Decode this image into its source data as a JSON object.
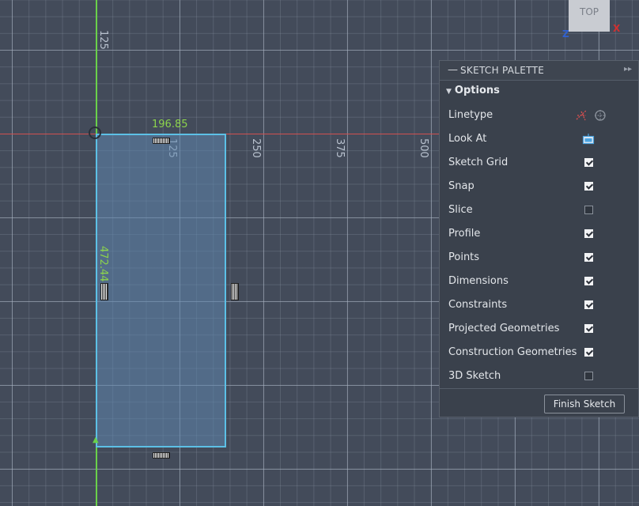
{
  "viewport": {
    "ticks": {
      "t1": "125",
      "t2": "125",
      "t3": "250",
      "t4": "375",
      "t5": "500"
    },
    "dimensions": {
      "width": "196.85",
      "height": "472.44"
    },
    "viewcube": {
      "face": "TOP",
      "axis_z": "Z",
      "axis_x": "X"
    },
    "colors": {
      "x_axis": "#d05050",
      "y_axis": "#6ad14a",
      "profile": "#5cc0e6",
      "dimension": "#8cd44c"
    }
  },
  "palette": {
    "title": "SKETCH PALETTE",
    "section": "Options",
    "rows": [
      {
        "label": "Linetype",
        "type": "icons"
      },
      {
        "label": "Look At",
        "type": "icon"
      },
      {
        "label": "Sketch Grid",
        "checked": true
      },
      {
        "label": "Snap",
        "checked": true
      },
      {
        "label": "Slice",
        "checked": false
      },
      {
        "label": "Profile",
        "checked": true
      },
      {
        "label": "Points",
        "checked": true
      },
      {
        "label": "Dimensions",
        "checked": true
      },
      {
        "label": "Constraints",
        "checked": true
      },
      {
        "label": "Projected Geometries",
        "checked": true
      },
      {
        "label": "Construction Geometries",
        "checked": true
      },
      {
        "label": "3D Sketch",
        "checked": false
      }
    ],
    "finish_label": "Finish Sketch",
    "icons": {
      "linetype_construction": "construction-line-icon",
      "linetype_centerline": "centerline-icon",
      "look_at": "look-at-icon"
    }
  }
}
